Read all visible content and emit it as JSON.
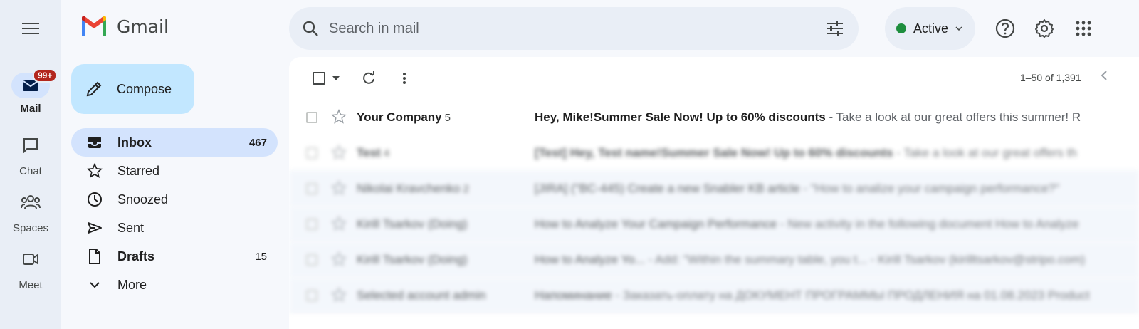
{
  "app": {
    "name": "Gmail"
  },
  "rail": {
    "menu_icon": "hamburger-icon",
    "items": [
      {
        "label": "Mail",
        "icon": "mail-icon",
        "badge": "99+",
        "active": true
      },
      {
        "label": "Chat",
        "icon": "chat-icon"
      },
      {
        "label": "Spaces",
        "icon": "spaces-icon"
      },
      {
        "label": "Meet",
        "icon": "meet-icon"
      }
    ]
  },
  "compose": {
    "label": "Compose"
  },
  "nav": [
    {
      "label": "Inbox",
      "count": "467",
      "icon": "inbox-icon",
      "active": true
    },
    {
      "label": "Starred",
      "count": "",
      "icon": "star-icon"
    },
    {
      "label": "Snoozed",
      "count": "",
      "icon": "clock-icon"
    },
    {
      "label": "Sent",
      "count": "",
      "icon": "send-icon"
    },
    {
      "label": "Drafts",
      "count": "15",
      "icon": "draft-icon",
      "bold": true
    },
    {
      "label": "More",
      "count": "",
      "icon": "chevron-down-icon"
    }
  ],
  "search": {
    "placeholder": "Search in mail"
  },
  "status": {
    "label": "Active",
    "color": "#1e8e3e"
  },
  "pager": {
    "text": "1–50 of 1,391"
  },
  "emails": [
    {
      "sender": "Your Company",
      "count": "5",
      "subject": "Hey, Mike!Summer Sale Now! Up to 60% discounts",
      "snippet": "Take a look at our great offers this summer! R",
      "blurred": false
    },
    {
      "sender": "Test",
      "count": "4",
      "subject": "[Test] Hey, Test name!Summer Sale Now! Up to 60% discounts",
      "snippet": "Take a look at our great offers th",
      "blurred": true
    },
    {
      "sender": "Nikolai Kravchenko",
      "count": "2",
      "subject": "[JIRA] (\"BC-445) Create a new Snabler KB article",
      "snippet": "\"How to analize your campaign performance?\"",
      "blurred": true
    },
    {
      "sender": "Kirill Tsarkov (Doing)",
      "count": "",
      "subject": "How to Analyze Your Campaign Performance",
      "snippet": "New activity in the following document How to Analyze",
      "blurred": true
    },
    {
      "sender": "Kirill Tsarkov (Doing)",
      "count": "",
      "subject": "How to Analyze Yo...",
      "snippet": "Add: \"Within the summary table, you t... - Kirill Tsarkov (kirilltsarkov@stripo.com)",
      "blurred": true
    },
    {
      "sender": "Selected account admin",
      "count": "",
      "subject": "Напоминание",
      "snippet": "Заказать-оплату на ДОКУМЕНТ ПРОГРАММЫ ПРОДЛЕНИЯ на 01.08.2023 Product",
      "blurred": true
    }
  ]
}
